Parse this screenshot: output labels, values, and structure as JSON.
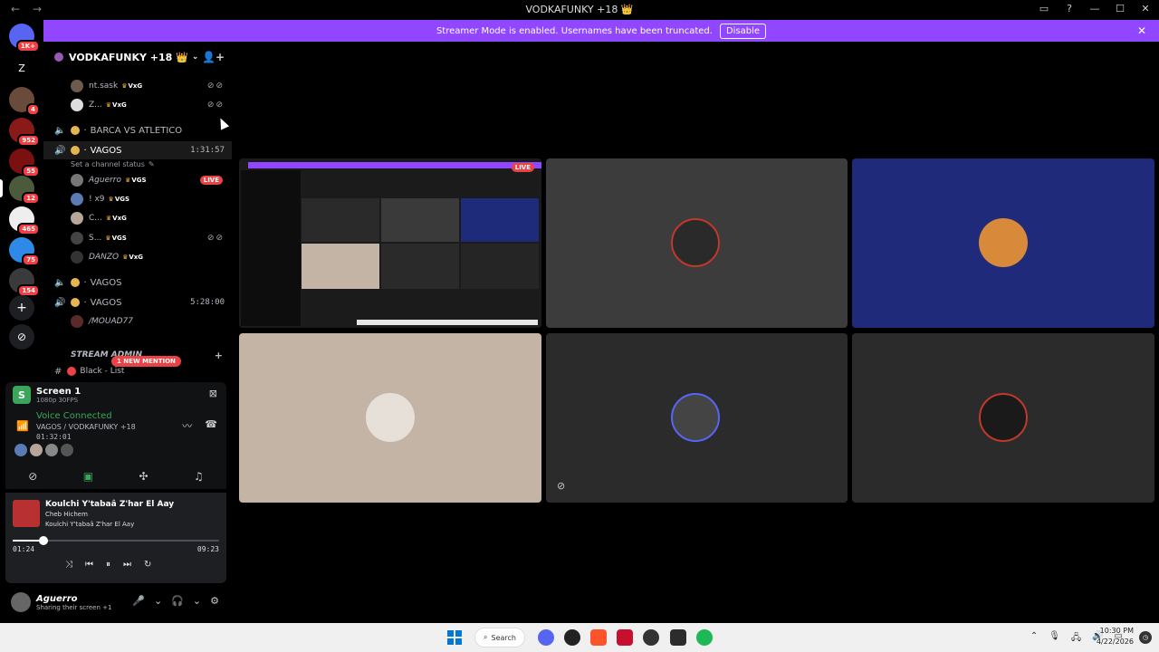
{
  "window": {
    "title": "VODKAFUNKY +18 👑",
    "back_glyph": "←",
    "forward_glyph": "→",
    "icons": [
      "inbox-icon",
      "help-icon",
      "minimize-icon",
      "maximize-icon",
      "close-icon"
    ]
  },
  "guilds": [
    {
      "name": "discord-home",
      "badge": "1K+"
    },
    {
      "name": "guild-2",
      "badge": ""
    },
    {
      "name": "guild-3",
      "badge": "4"
    },
    {
      "name": "guild-4",
      "badge": "952"
    },
    {
      "name": "guild-5",
      "badge": "55"
    },
    {
      "name": "guild-6",
      "badge": "12"
    },
    {
      "name": "guild-7",
      "badge": "465"
    },
    {
      "name": "guild-8",
      "badge": "75"
    },
    {
      "name": "guild-9",
      "badge": "154"
    }
  ],
  "banner": {
    "message": "Streamer Mode is enabled. Usernames have been truncated.",
    "disable_label": "Disable",
    "close_glyph": "✕"
  },
  "server": {
    "name": "VODKAFUNKY +18 👑",
    "chevron": "⌄"
  },
  "channel_list": {
    "users_top": [
      {
        "name": "nt.sask",
        "tag": "VxG"
      },
      {
        "name": "Z...",
        "tag": "VxG"
      }
    ],
    "channel_barca": "BARCA VS ATLETICO",
    "channel_vagos_active": "VAGOS",
    "channel_vagos_timer": "1:31:57",
    "channel_status": "Set a channel status",
    "users_vagos": [
      {
        "name": "Aguerro",
        "tag": "VGS",
        "live": "LIVE"
      },
      {
        "name": "! x9",
        "tag": "VGS"
      },
      {
        "name": "C...",
        "tag": "VxG"
      },
      {
        "name": "S...",
        "tag": "VGS"
      },
      {
        "name": "DANZO",
        "tag": "VxG"
      }
    ],
    "channel_vagos_2": "VAGOS",
    "channel_vagos_3": "VAGOS",
    "channel_vagos_3_timer": "5:28:00",
    "user_mouad": "/MOUAD77",
    "category_stream_admin": "STREAM ADMIN",
    "channel_black_list": "Black - List",
    "mention_pill": "1 NEW MENTION",
    "dot": "·"
  },
  "screen_share": {
    "title": "Screen 1",
    "quality": "1080p 30FPS"
  },
  "voice": {
    "connected": "Voice Connected",
    "channel": "VAGOS / VODKAFUNKY +18",
    "elapsed": "01:32:01"
  },
  "music": {
    "title": "Koulchi Y'tabaâ Z'har El Aay",
    "artist": "Cheb Hichem",
    "album": "Koulchi Y'tabaâ Z'har El Aay",
    "current": "01:24",
    "total": "09:23",
    "progress": 0.15
  },
  "user": {
    "name": "Aguerro",
    "status": "Sharing their screen +1"
  },
  "taskbar": {
    "search_label": "Search",
    "time": "10:30 PM",
    "date": "4/22/2026"
  },
  "tiles": {
    "stream_live": "LIVE"
  },
  "colors": {
    "accent": "#9146ff",
    "live": "#ed4245",
    "online": "#3ba55c"
  }
}
